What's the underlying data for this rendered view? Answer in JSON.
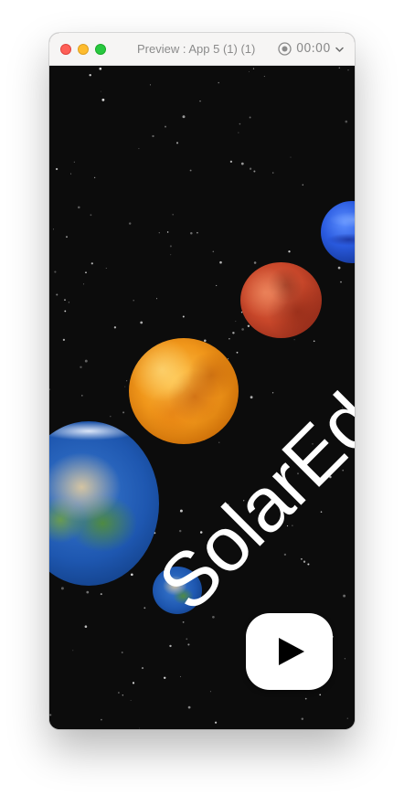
{
  "window": {
    "title": "Preview : App 5 (1) (1)",
    "timer": "00:00",
    "record_icon": "record-icon",
    "chevron_icon": "chevron-down-icon"
  },
  "app": {
    "brand_text": "SolarEdu",
    "background_color": "#0c0c0c",
    "planets": [
      "neptune",
      "mars",
      "venus",
      "earth",
      "earth"
    ],
    "play_button_icon": "play-icon"
  }
}
